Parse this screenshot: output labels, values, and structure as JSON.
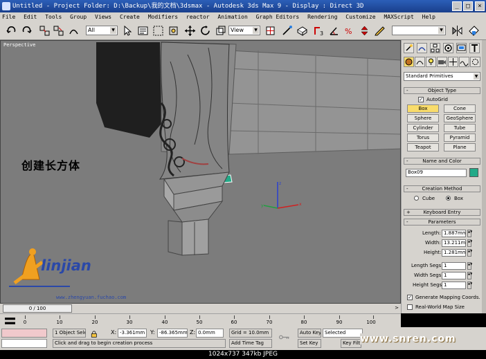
{
  "titlebar": {
    "title": "Untitled      - Project Folder: D:\\Backup\\我的文档\\3dsmax     - Autodesk 3ds Max 9        - Display : Direct 3D",
    "min": "_",
    "max": "□",
    "close": "×"
  },
  "menu": [
    "File",
    "Edit",
    "Tools",
    "Group",
    "Views",
    "Create",
    "Modifiers",
    "reactor",
    "Animation",
    "Graph Editors",
    "Rendering",
    "Customize",
    "MAXScript",
    "Help"
  ],
  "toolbar": {
    "selection_filter": "All",
    "ref_coord": "View"
  },
  "viewport": {
    "label": "Perspective",
    "annotation": "创建长方体",
    "logo_text": "linjian",
    "logo_url": "www.zhengyuan.fuchao.com"
  },
  "command_panel": {
    "category_dropdown": "Standard Primitives",
    "rollouts": {
      "object_type": "Object Type",
      "name_color": "Name and Color",
      "creation_method": "Creation Method",
      "keyboard_entry": "Keyboard Entry",
      "parameters": "Parameters"
    },
    "autogrid_label": "AutoGrid",
    "primitive_buttons": [
      "Box",
      "Cone",
      "Sphere",
      "GeoSphere",
      "Cylinder",
      "Tube",
      "Torus",
      "Pyramid",
      "Teapot",
      "Plane"
    ],
    "active_primitive": "Box",
    "object_name": "Box09",
    "object_color": "#22aa88",
    "creation_options": [
      "Cube",
      "Box"
    ],
    "creation_selected": "Box",
    "params": [
      {
        "label": "Length:",
        "value": "1.887mm"
      },
      {
        "label": "Width:",
        "value": "13.211mm"
      },
      {
        "label": "Height:",
        "value": "1.281mm"
      }
    ],
    "segs": [
      {
        "label": "Length Segs:",
        "value": "1"
      },
      {
        "label": "Width Segs:",
        "value": "1"
      },
      {
        "label": "Height Segs:",
        "value": "1"
      }
    ],
    "generate_mapping": "Generate Mapping Coords.",
    "real_world": "Real-World Map Size"
  },
  "timeline": {
    "slider_text": "0 / 100",
    "ticks": [
      "0",
      "10",
      "20",
      "30",
      "40",
      "50",
      "60",
      "70",
      "80",
      "90",
      "100"
    ]
  },
  "status": {
    "selection_count": "1 Object Sele",
    "prompt": "Click and drag to begin creation process",
    "x_label": "X:",
    "x_value": "-3.361mm",
    "y_label": "Y:",
    "y_value": "-86.365mm",
    "z_label": "Z:",
    "z_value": "0.0mm",
    "grid": "Grid = 10.0mm",
    "add_time_tag": "Add Time Tag",
    "auto_key": "Auto Key",
    "set_key": "Set Key",
    "selected": "Selected",
    "key_filters": "Key Filte",
    "watermark": "www.snren.com"
  },
  "caption": "1024x737  347kb  JPEG"
}
